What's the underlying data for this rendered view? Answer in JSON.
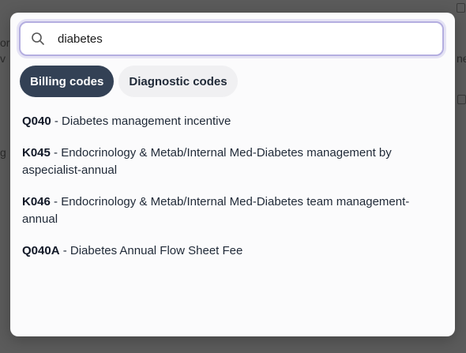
{
  "search": {
    "value": "diabetes",
    "icon": "search-icon"
  },
  "tabs": [
    {
      "label": "Billing codes",
      "active": true
    },
    {
      "label": "Diagnostic codes",
      "active": false
    }
  ],
  "results": [
    {
      "code": "Q040",
      "separator": " - ",
      "description": "Diabetes management incentive"
    },
    {
      "code": "K045",
      "separator": " - ",
      "description": "Endocrinology & Metab/Internal Med-Diabetes management by aspecialist-annual"
    },
    {
      "code": "K046",
      "separator": " - ",
      "description": "Endocrinology & Metab/Internal Med-Diabetes team management-annual"
    },
    {
      "code": "Q040A",
      "separator": " - ",
      "description": "Diabetes Annual Flow Sheet Fee"
    }
  ],
  "colors": {
    "active_tab": "#334155",
    "focus_ring": "#b4aee0",
    "backdrop": "#5b5b5b"
  }
}
